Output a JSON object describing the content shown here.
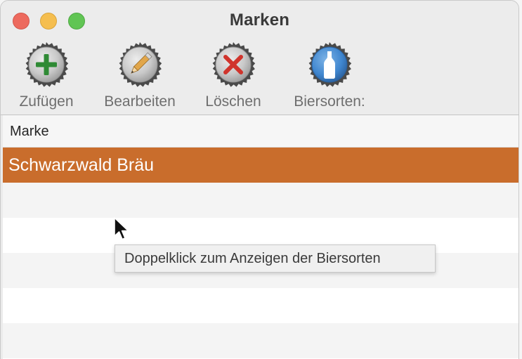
{
  "window": {
    "title": "Marken"
  },
  "toolbar": {
    "add_label": "Zufügen",
    "edit_label": "Bearbeiten",
    "delete_label": "Löschen",
    "beer_types_label": "Biersorten:"
  },
  "table": {
    "columns": [
      "Marke"
    ],
    "rows": [
      {
        "marke": "Schwarzwald Bräu",
        "selected": true
      }
    ]
  },
  "tooltip": {
    "text": "Doppelklick zum Anzeigen der Biersorten"
  },
  "colors": {
    "selection": "#c96d2c",
    "close": "#ed6a5e",
    "minimize": "#f5be4f",
    "maximize": "#61c554"
  },
  "icons": {
    "add": "plus-cap-icon",
    "edit": "pencil-cap-icon",
    "delete": "x-cap-icon",
    "beer_types": "bottle-cap-icon"
  }
}
